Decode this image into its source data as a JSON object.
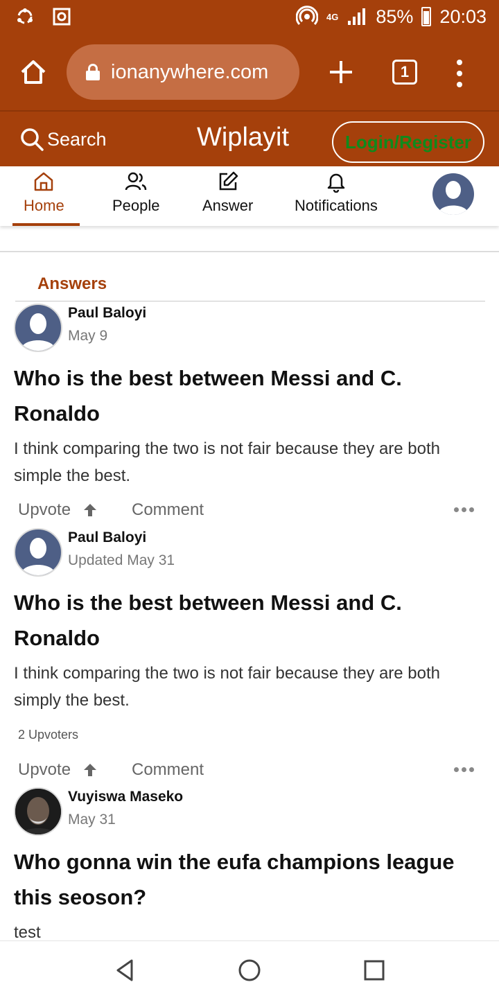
{
  "status_bar": {
    "network": "4G",
    "battery": "85%",
    "time": "20:03"
  },
  "browser": {
    "url": "ionanywhere.com",
    "tab_count": "1"
  },
  "site": {
    "search_label": "Search",
    "title": "Wiplayit",
    "login_label": "Login/Register",
    "accent_color": "#a5400b",
    "login_text_color": "#0f8a1c"
  },
  "nav": {
    "items": [
      {
        "label": "Home",
        "icon": "home-icon",
        "active": true
      },
      {
        "label": "People",
        "icon": "people-icon"
      },
      {
        "label": "Answer",
        "icon": "edit-icon"
      },
      {
        "label": "Notifications",
        "icon": "bell-icon"
      }
    ]
  },
  "section": {
    "title": "Answers"
  },
  "answers": [
    {
      "author": "Paul Baloyi",
      "date": "May 9",
      "question": "Who is the best between Messi and C. Ronaldo",
      "body": "I think comparing the two is not fair because they are both simple the best.",
      "upvote_label": "Upvote",
      "comment_label": "Comment"
    },
    {
      "author": "Paul Baloyi",
      "date": "Updated May 31",
      "question": "Who is the best between Messi and C. Ronaldo",
      "body": "I think comparing the two is not fair because they are both simply the best.",
      "upvoters": "2 Upvoters",
      "upvote_label": "Upvote",
      "comment_label": "Comment"
    },
    {
      "author": "Vuyiswa Maseko",
      "date": "May 31",
      "question": "Who gonna win the eufa champions league this seoson?",
      "body": "test"
    }
  ]
}
